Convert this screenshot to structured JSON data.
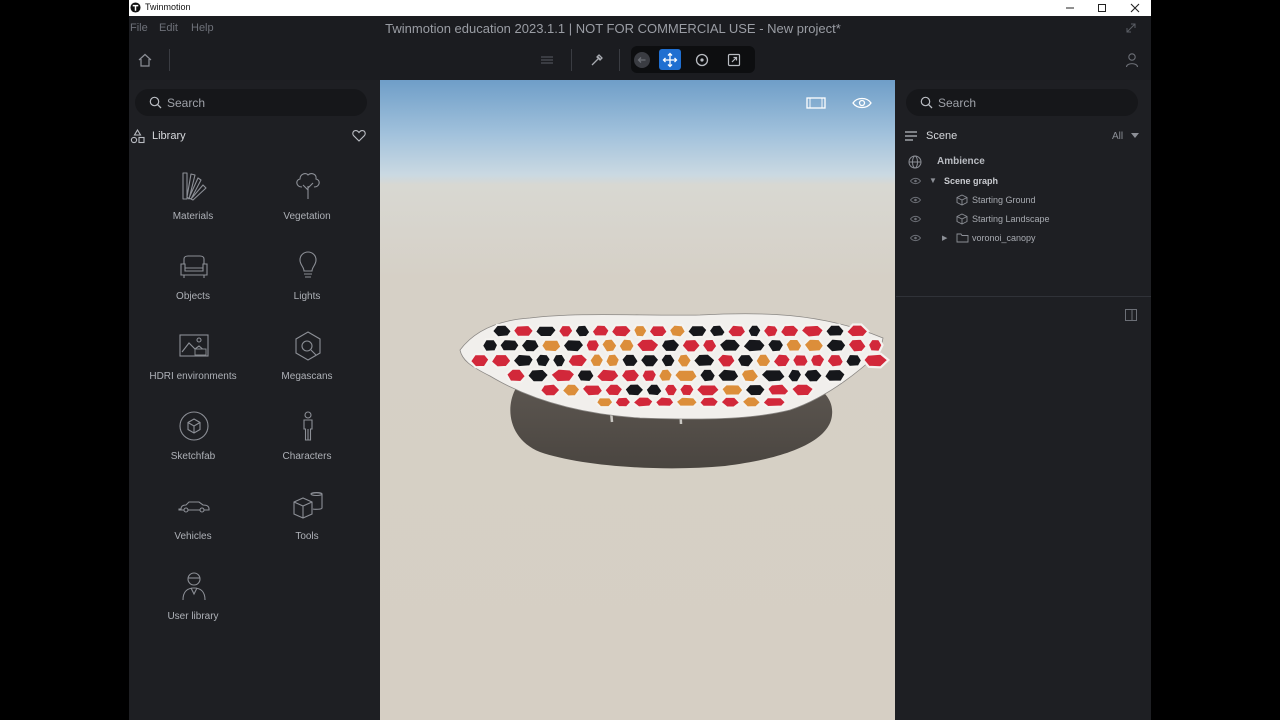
{
  "window": {
    "os_title": "Twinmotion",
    "app_title": "Twinmotion education 2023.1.1 | NOT FOR COMMERCIAL USE - New project*"
  },
  "menu": [
    "File",
    "Edit",
    "Help"
  ],
  "library": {
    "search_placeholder": "Search",
    "title": "Library",
    "items": [
      {
        "label": "Materials",
        "icon": "materials-fan-icon"
      },
      {
        "label": "Vegetation",
        "icon": "tree-icon"
      },
      {
        "label": "Objects",
        "icon": "armchair-icon"
      },
      {
        "label": "Lights",
        "icon": "lightbulb-icon"
      },
      {
        "label": "HDRI environments",
        "icon": "hdri-image-icon"
      },
      {
        "label": "Megascans",
        "icon": "megascans-icon"
      },
      {
        "label": "Sketchfab",
        "icon": "sketchfab-icon"
      },
      {
        "label": "Characters",
        "icon": "person-icon"
      },
      {
        "label": "Vehicles",
        "icon": "car-icon"
      },
      {
        "label": "Tools",
        "icon": "tools-box-icon"
      },
      {
        "label": "User library",
        "icon": "user-library-icon"
      }
    ]
  },
  "scene": {
    "search_placeholder": "Search",
    "title": "Scene",
    "filter": "All",
    "tree": [
      {
        "label": "Ambience",
        "icon": "globe-icon"
      },
      {
        "label": "Scene graph",
        "icon": "eye-icon"
      },
      {
        "label": "Starting Ground",
        "icon": "object-icon"
      },
      {
        "label": "Starting Landscape",
        "icon": "object-icon"
      },
      {
        "label": "voronoi_canopy",
        "icon": "folder-icon"
      }
    ]
  },
  "colors": {
    "accent_blue": "#1f6fd1",
    "panel_bg": "#1e1f23",
    "canopy_red": "#d2283a",
    "canopy_orange": "#dc8e3a",
    "canopy_black": "#16171b"
  }
}
